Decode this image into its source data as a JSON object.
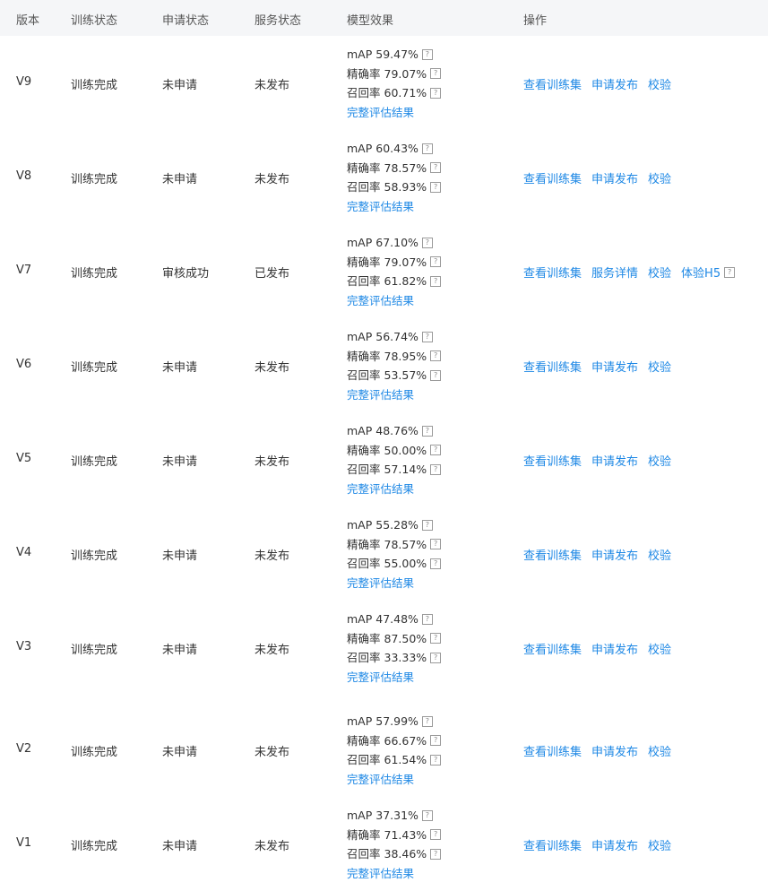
{
  "headers": {
    "version": "版本",
    "train_status": "训练状态",
    "apply_status": "申请状态",
    "service_status": "服务状态",
    "model_effect": "模型效果",
    "actions": "操作"
  },
  "metric_labels": {
    "map": "mAP",
    "precision": "精确率",
    "recall": "召回率"
  },
  "help_icon": "?",
  "full_eval_label": "完整评估结果",
  "rows": [
    {
      "version": "V9",
      "train": "训练完成",
      "apply": "未申请",
      "service": "未发布",
      "map": "59.47%",
      "precision": "79.07%",
      "recall": "60.71%",
      "actions": [
        "查看训练集",
        "申请发布",
        "校验"
      ]
    },
    {
      "version": "V8",
      "train": "训练完成",
      "apply": "未申请",
      "service": "未发布",
      "map": "60.43%",
      "precision": "78.57%",
      "recall": "58.93%",
      "actions": [
        "查看训练集",
        "申请发布",
        "校验"
      ]
    },
    {
      "version": "V7",
      "train": "训练完成",
      "apply": "审核成功",
      "service": "已发布",
      "map": "67.10%",
      "precision": "79.07%",
      "recall": "61.82%",
      "actions": [
        "查看训练集",
        "服务详情",
        "校验",
        "体验H5"
      ]
    },
    {
      "version": "V6",
      "train": "训练完成",
      "apply": "未申请",
      "service": "未发布",
      "map": "56.74%",
      "precision": "78.95%",
      "recall": "53.57%",
      "actions": [
        "查看训练集",
        "申请发布",
        "校验"
      ]
    },
    {
      "version": "V5",
      "train": "训练完成",
      "apply": "未申请",
      "service": "未发布",
      "map": "48.76%",
      "precision": "50.00%",
      "recall": "57.14%",
      "actions": [
        "查看训练集",
        "申请发布",
        "校验"
      ]
    },
    {
      "version": "V4",
      "train": "训练完成",
      "apply": "未申请",
      "service": "未发布",
      "map": "55.28%",
      "precision": "78.57%",
      "recall": "55.00%",
      "actions": [
        "查看训练集",
        "申请发布",
        "校验"
      ]
    },
    {
      "version": "V3",
      "train": "训练完成",
      "apply": "未申请",
      "service": "未发布",
      "map": "47.48%",
      "precision": "87.50%",
      "recall": "33.33%",
      "actions": [
        "查看训练集",
        "申请发布",
        "校验"
      ]
    },
    {
      "version": "V2",
      "train": "训练完成",
      "apply": "未申请",
      "service": "未发布",
      "map": "57.99%",
      "precision": "66.67%",
      "recall": "61.54%",
      "actions": [
        "查看训练集",
        "申请发布",
        "校验"
      ]
    },
    {
      "version": "V1",
      "train": "训练完成",
      "apply": "未申请",
      "service": "未发布",
      "map": "37.31%",
      "precision": "71.43%",
      "recall": "38.46%",
      "actions": [
        "查看训练集",
        "申请发布",
        "校验"
      ]
    }
  ]
}
